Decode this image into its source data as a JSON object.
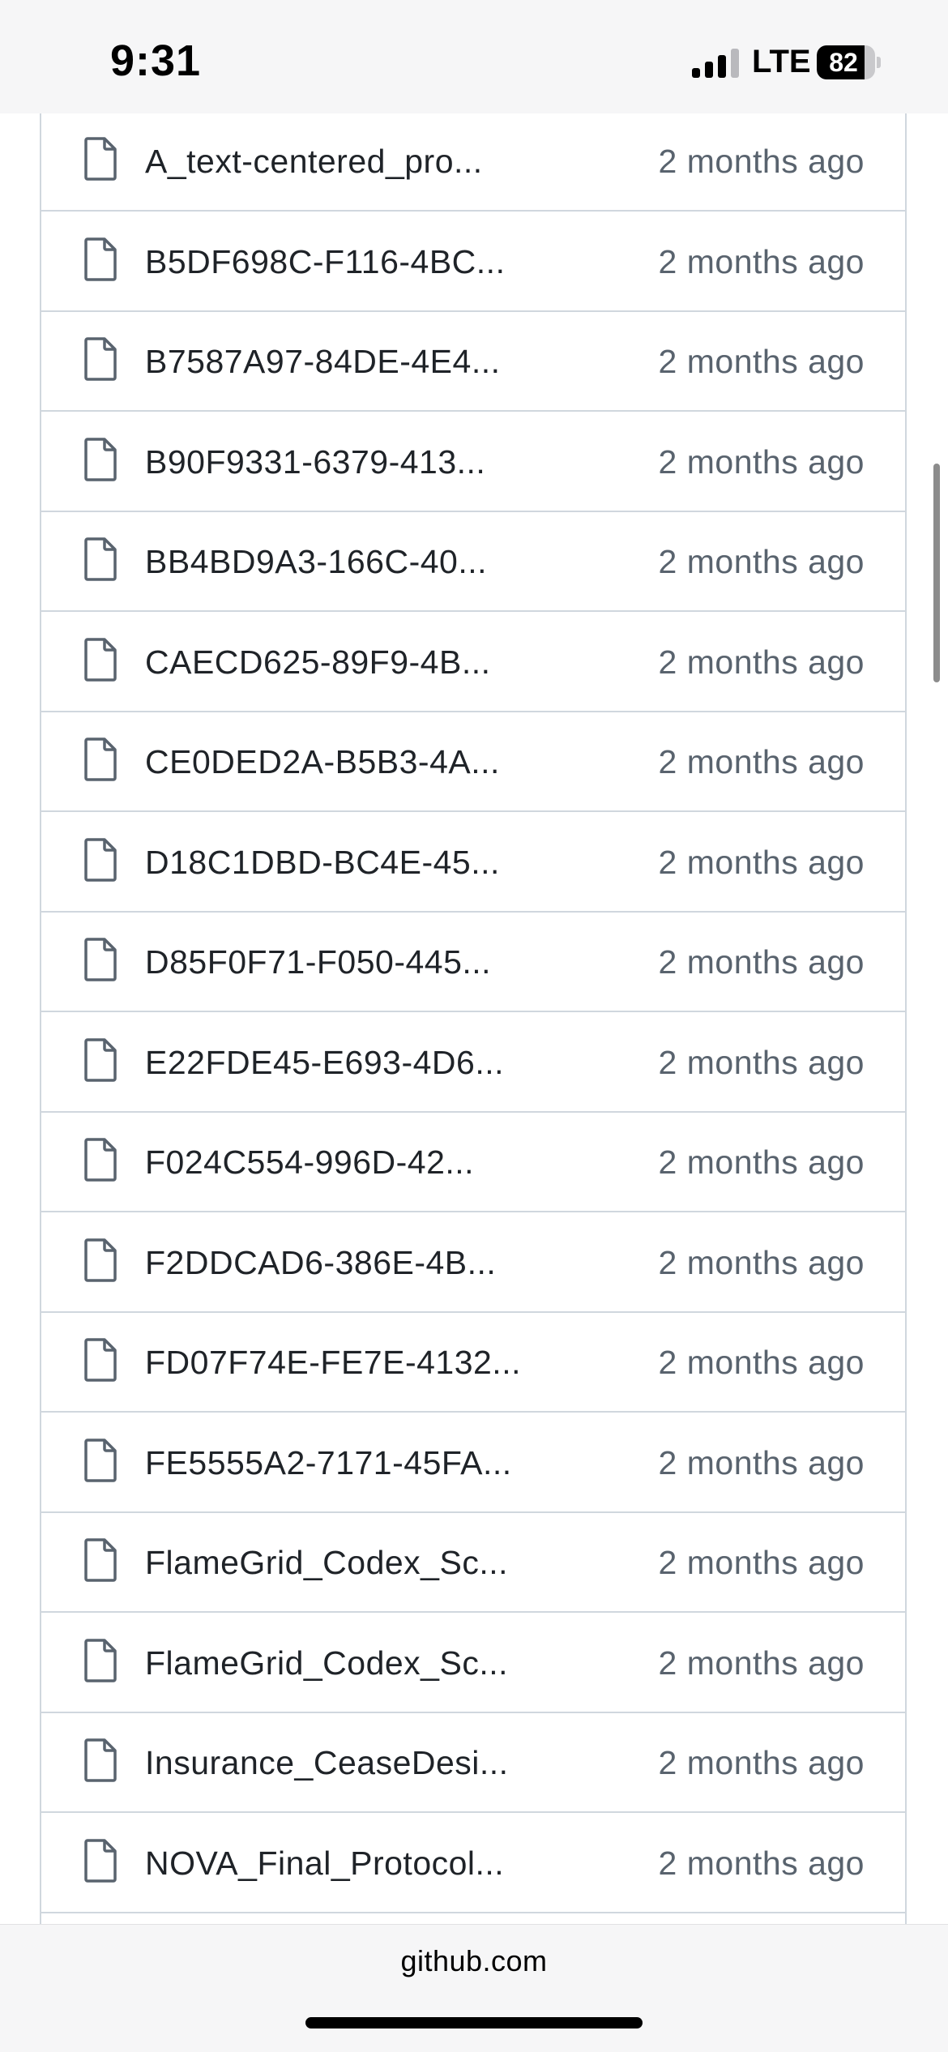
{
  "status_bar": {
    "time": "9:31",
    "network": "LTE",
    "battery_level": "82",
    "battery_fraction": 0.82
  },
  "files": [
    {
      "name": "A_text-centered_pro...",
      "modified": "2 months ago",
      "icon": "file-icon"
    },
    {
      "name": "B5DF698C-F116-4BC...",
      "modified": "2 months ago",
      "icon": "file-icon"
    },
    {
      "name": "B7587A97-84DE-4E4...",
      "modified": "2 months ago",
      "icon": "file-icon"
    },
    {
      "name": "B90F9331-6379-413...",
      "modified": "2 months ago",
      "icon": "file-icon"
    },
    {
      "name": "BB4BD9A3-166C-40...",
      "modified": "2 months ago",
      "icon": "file-icon"
    },
    {
      "name": "CAECD625-89F9-4B...",
      "modified": "2 months ago",
      "icon": "file-icon"
    },
    {
      "name": "CE0DED2A-B5B3-4A...",
      "modified": "2 months ago",
      "icon": "file-icon"
    },
    {
      "name": "D18C1DBD-BC4E-45...",
      "modified": "2 months ago",
      "icon": "file-icon"
    },
    {
      "name": "D85F0F71-F050-445...",
      "modified": "2 months ago",
      "icon": "file-icon"
    },
    {
      "name": "E22FDE45-E693-4D6...",
      "modified": "2 months ago",
      "icon": "file-icon"
    },
    {
      "name": "F024C554-996D-42...",
      "modified": "2 months ago",
      "icon": "file-icon"
    },
    {
      "name": "F2DDCAD6-386E-4B...",
      "modified": "2 months ago",
      "icon": "file-icon"
    },
    {
      "name": "FD07F74E-FE7E-4132...",
      "modified": "2 months ago",
      "icon": "file-icon"
    },
    {
      "name": "FE5555A2-7171-45FA...",
      "modified": "2 months ago",
      "icon": "file-icon"
    },
    {
      "name": "FlameGrid_Codex_Sc...",
      "modified": "2 months ago",
      "icon": "file-icon"
    },
    {
      "name": "FlameGrid_Codex_Sc...",
      "modified": "2 months ago",
      "icon": "file-icon"
    },
    {
      "name": "Insurance_CeaseDesi...",
      "modified": "2 months ago",
      "icon": "file-icon"
    },
    {
      "name": "NOVA_Final_Protocol...",
      "modified": "2 months ago",
      "icon": "file-icon"
    }
  ],
  "browser": {
    "url": "github.com"
  },
  "colors": {
    "border": "#d0d7de",
    "file_name": "#1f2328",
    "date": "#59636e",
    "icon": "#59636e"
  }
}
